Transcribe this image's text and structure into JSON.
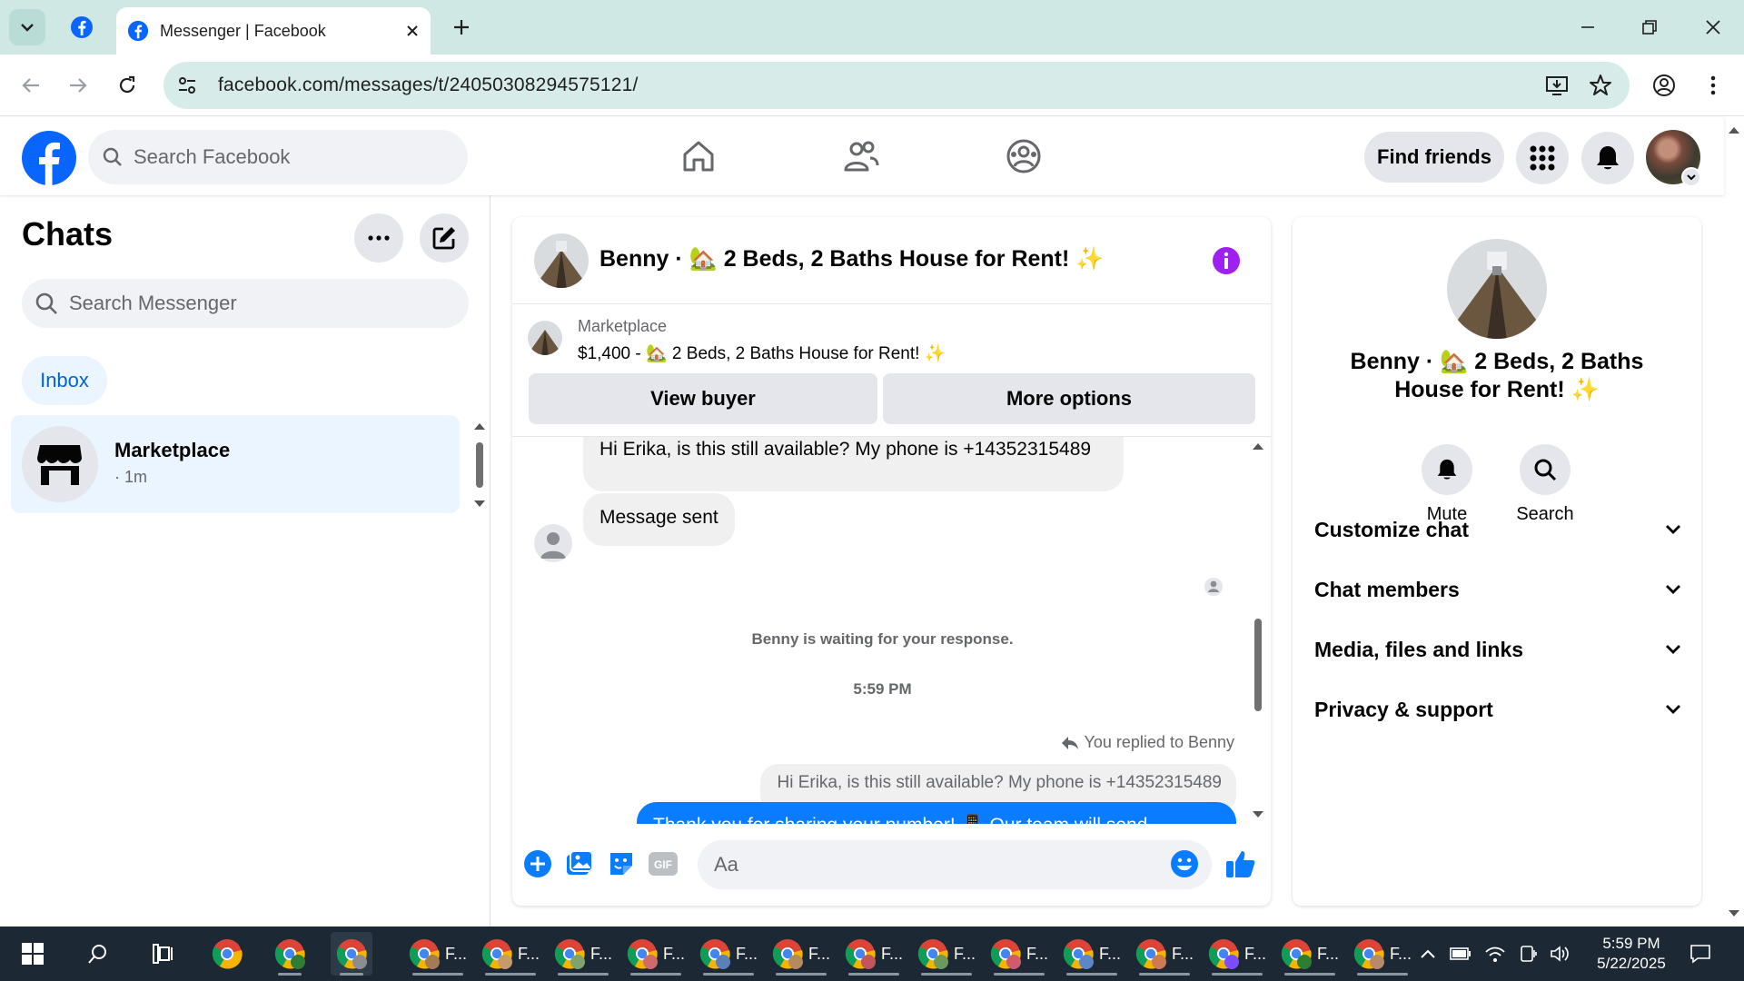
{
  "browser": {
    "tab_title": "Messenger | Facebook",
    "url": "facebook.com/messages/t/24050308294575121/",
    "accent_color": "#cfe8e4"
  },
  "fb_header": {
    "search_placeholder": "Search Facebook",
    "find_friends_label": "Find friends",
    "brand_color": "#0866ff"
  },
  "sidebar": {
    "title": "Chats",
    "search_placeholder": "Search Messenger",
    "filter_label": "Inbox",
    "chats": [
      {
        "name": "Marketplace",
        "time": "· 1m",
        "icon": "store-icon"
      }
    ]
  },
  "conversation": {
    "title": "Benny · 🏡 2 Beds, 2 Baths House for Rent! ✨",
    "marketplace_label": "Marketplace",
    "listing_line": "$1,400 - 🏡 2 Beds, 2 Baths House for Rent! ✨",
    "view_buyer_label": "View buyer",
    "more_options_label": "More options",
    "messages": {
      "incoming_1": "Hi Erika, is this still available? My phone is +14352315489",
      "incoming_2": "Message sent",
      "waiting_notice": "Benny is waiting for your response.",
      "timestamp": "5:59 PM",
      "replied_label": "You replied to Benny",
      "quoted": "Hi Erika, is this still available? My phone is +14352315489",
      "outgoing_partial": "Thank you for sharing your number! 📱 Our team will send"
    },
    "compose_placeholder": "Aa",
    "message_blue": "#0a7cff"
  },
  "info_panel": {
    "name": "Benny · 🏡 2 Beds, 2 Baths House for Rent! ✨",
    "mute_label": "Mute",
    "search_label": "Search",
    "sections": [
      "Customize chat",
      "Chat members",
      "Media, files and links",
      "Privacy & support"
    ]
  },
  "taskbar": {
    "app_label": "F...",
    "clock_time": "5:59 PM",
    "clock_date": "5/22/2025"
  }
}
